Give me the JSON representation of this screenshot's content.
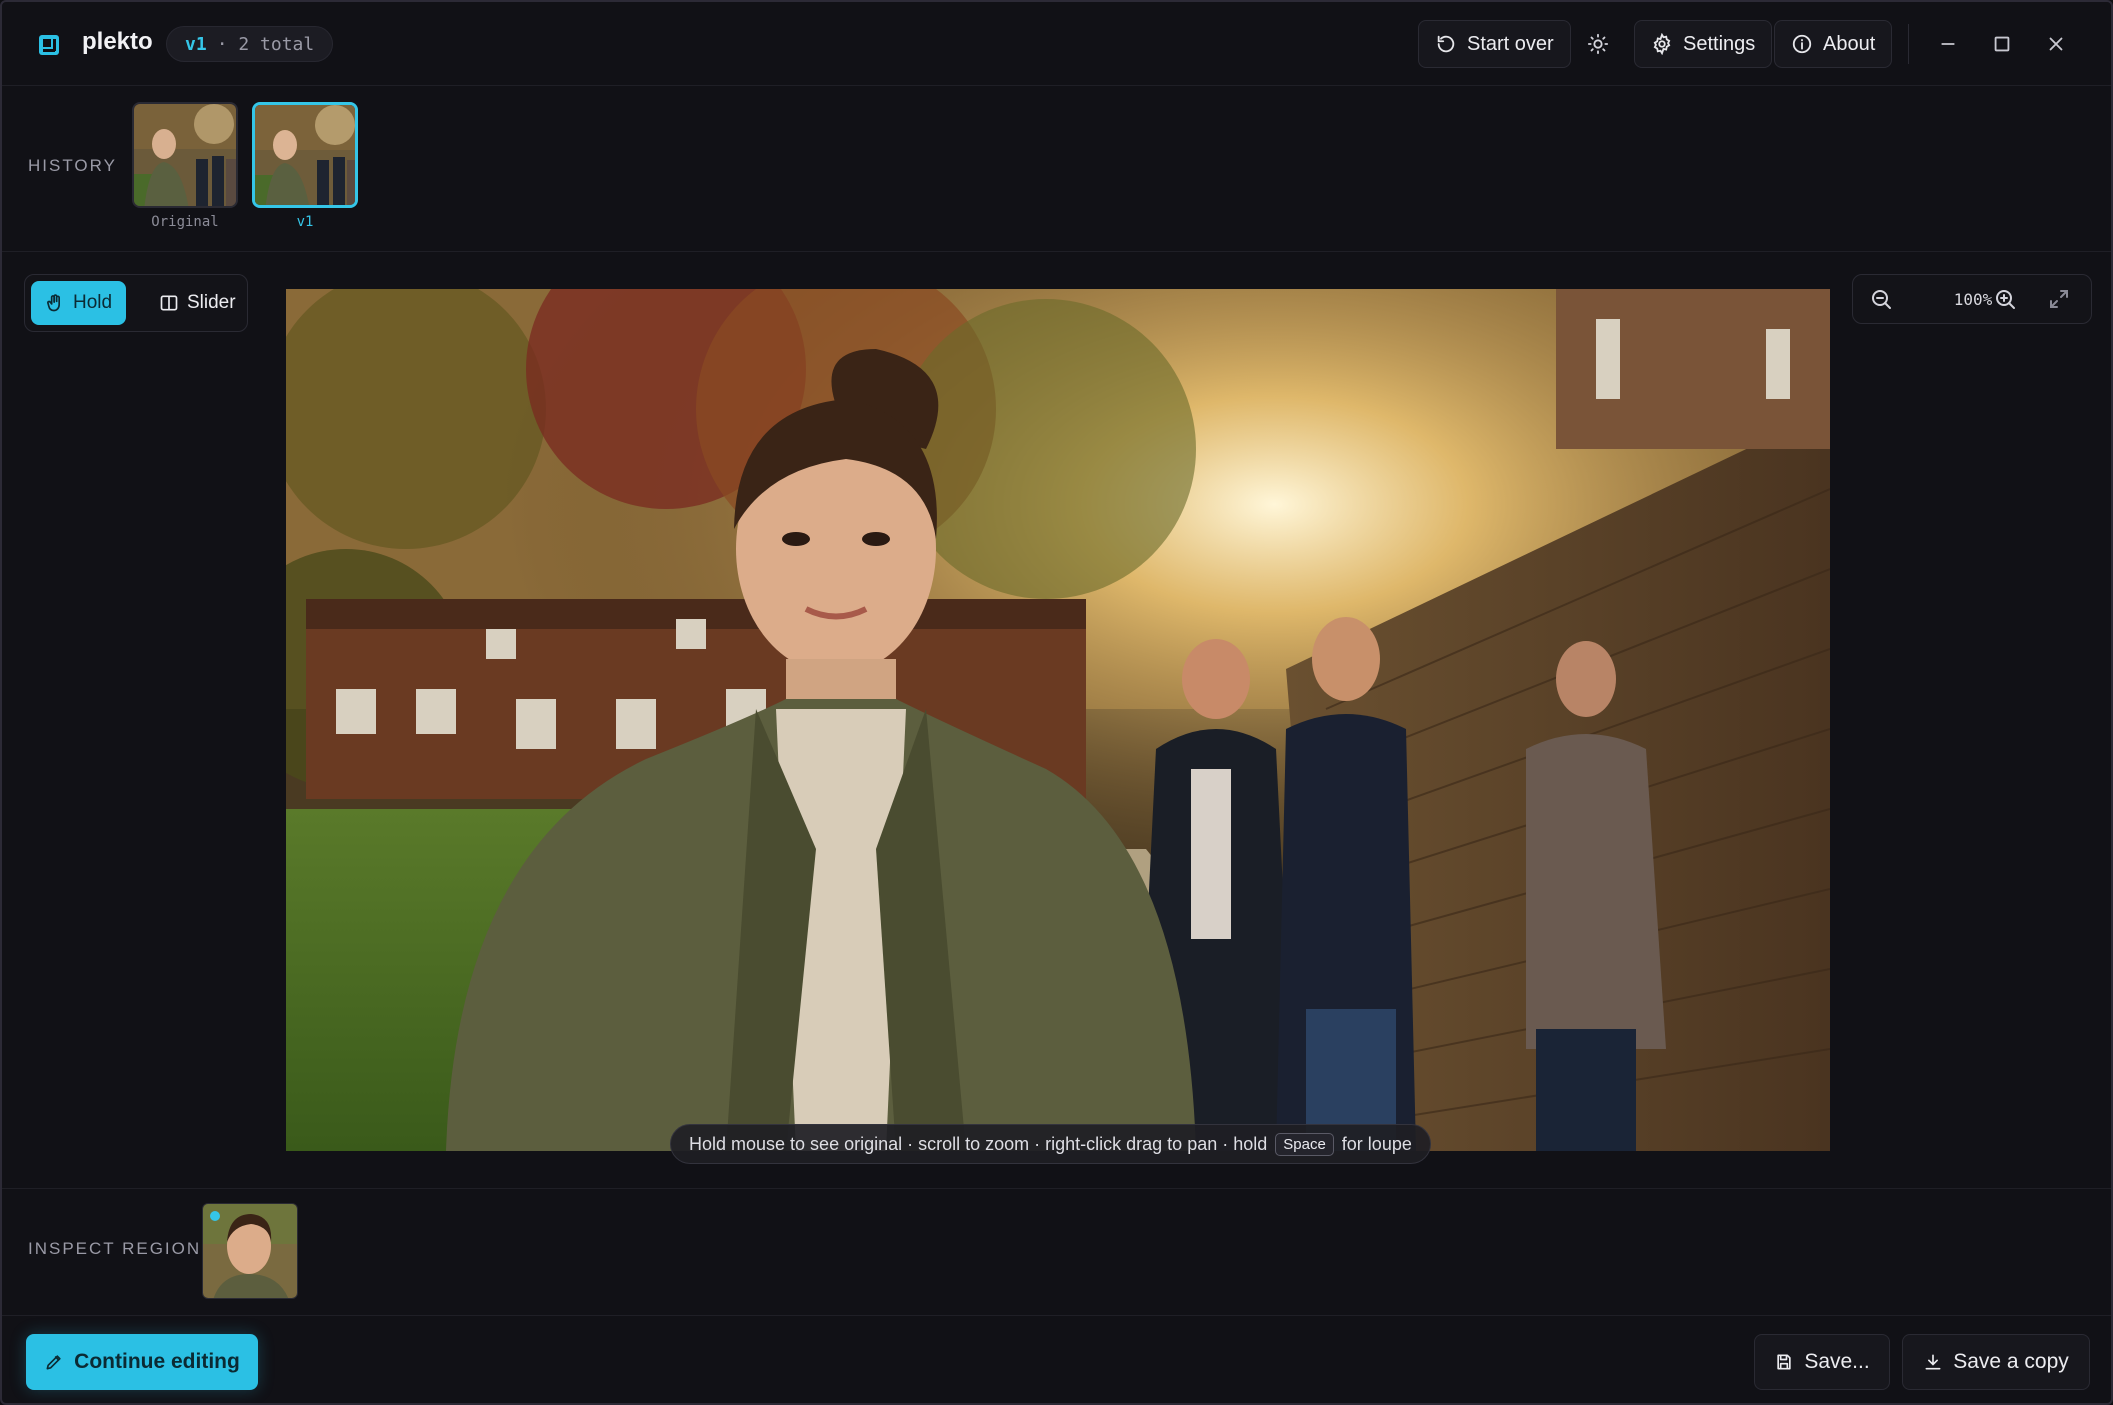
{
  "app": {
    "name": "plekto",
    "version": "v1",
    "total": "· 2 total"
  },
  "toolbar": {
    "start_over": "Start over",
    "settings": "Settings",
    "about": "About"
  },
  "history": {
    "label": "HISTORY",
    "items": [
      {
        "caption": "Original",
        "active": false
      },
      {
        "caption": "v1",
        "active": true
      }
    ]
  },
  "mode": {
    "hold": "Hold",
    "slider": "Slider",
    "selected": "Hold"
  },
  "zoom": {
    "level": "100%"
  },
  "hint": {
    "text_before": "Hold mouse to see original · scroll to zoom · right-click drag to pan · hold",
    "key": "Space",
    "text_after": "for loupe"
  },
  "inspect": {
    "label": "INSPECT REGION"
  },
  "footer": {
    "continue": "Continue editing",
    "save": "Save...",
    "save_copy": "Save a copy"
  },
  "colors": {
    "accent": "#2bc0e4",
    "background": "#111116"
  }
}
